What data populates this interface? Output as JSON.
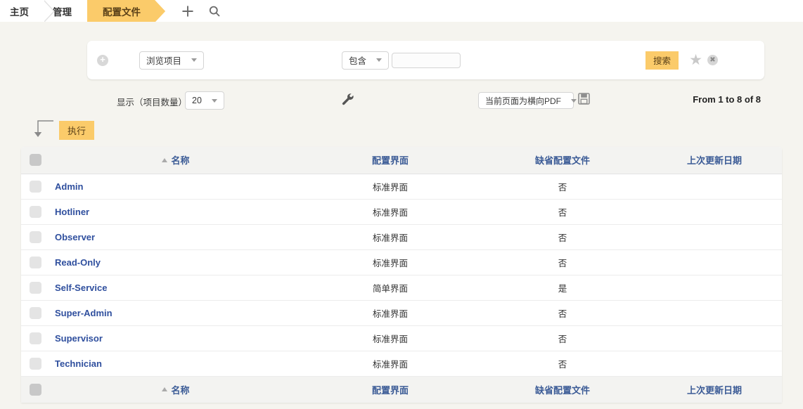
{
  "breadcrumb": {
    "items": [
      {
        "label": "主页",
        "active": false
      },
      {
        "label": "管理",
        "active": false
      },
      {
        "label": "配置文件",
        "active": true
      }
    ],
    "add_icon": "plus-icon",
    "search_icon": "search-icon"
  },
  "search_panel": {
    "add_criterion_label": "+",
    "field_select": "浏览项目",
    "condition_select": "包含",
    "value_input": "",
    "value_placeholder": "",
    "search_button": "搜索",
    "favorite_icon": "star-icon",
    "clear_icon": "close-circle-icon"
  },
  "options": {
    "show_label": "显示（项目数量）",
    "page_size": "20",
    "settings_icon": "wrench-icon",
    "export_format": "当前页面为横向PDF",
    "save_icon": "floppy-disk-icon",
    "counter": "From 1 to 8 of 8"
  },
  "actions": {
    "branch_icon": "hook-arrow-icon",
    "execute_button": "执行"
  },
  "table": {
    "columns": [
      "名称",
      "配置界面",
      "缺省配置文件",
      "上次更新日期"
    ],
    "sort_column": "名称",
    "sort_direction": "asc",
    "rows": [
      {
        "name": "Admin",
        "ui": "标准界面",
        "default": "否",
        "updated": ""
      },
      {
        "name": "Hotliner",
        "ui": "标准界面",
        "default": "否",
        "updated": ""
      },
      {
        "name": "Observer",
        "ui": "标准界面",
        "default": "否",
        "updated": ""
      },
      {
        "name": "Read-Only",
        "ui": "标准界面",
        "default": "否",
        "updated": ""
      },
      {
        "name": "Self-Service",
        "ui": "简单界面",
        "default": "是",
        "updated": ""
      },
      {
        "name": "Super-Admin",
        "ui": "标准界面",
        "default": "否",
        "updated": ""
      },
      {
        "name": "Supervisor",
        "ui": "标准界面",
        "default": "否",
        "updated": ""
      },
      {
        "name": "Technician",
        "ui": "标准界面",
        "default": "否",
        "updated": ""
      }
    ]
  },
  "colors": {
    "accent": "#fbcb6a",
    "link": "#2f4f9e",
    "header_text": "#3b5b96",
    "page_bg": "#f5f4ef"
  }
}
